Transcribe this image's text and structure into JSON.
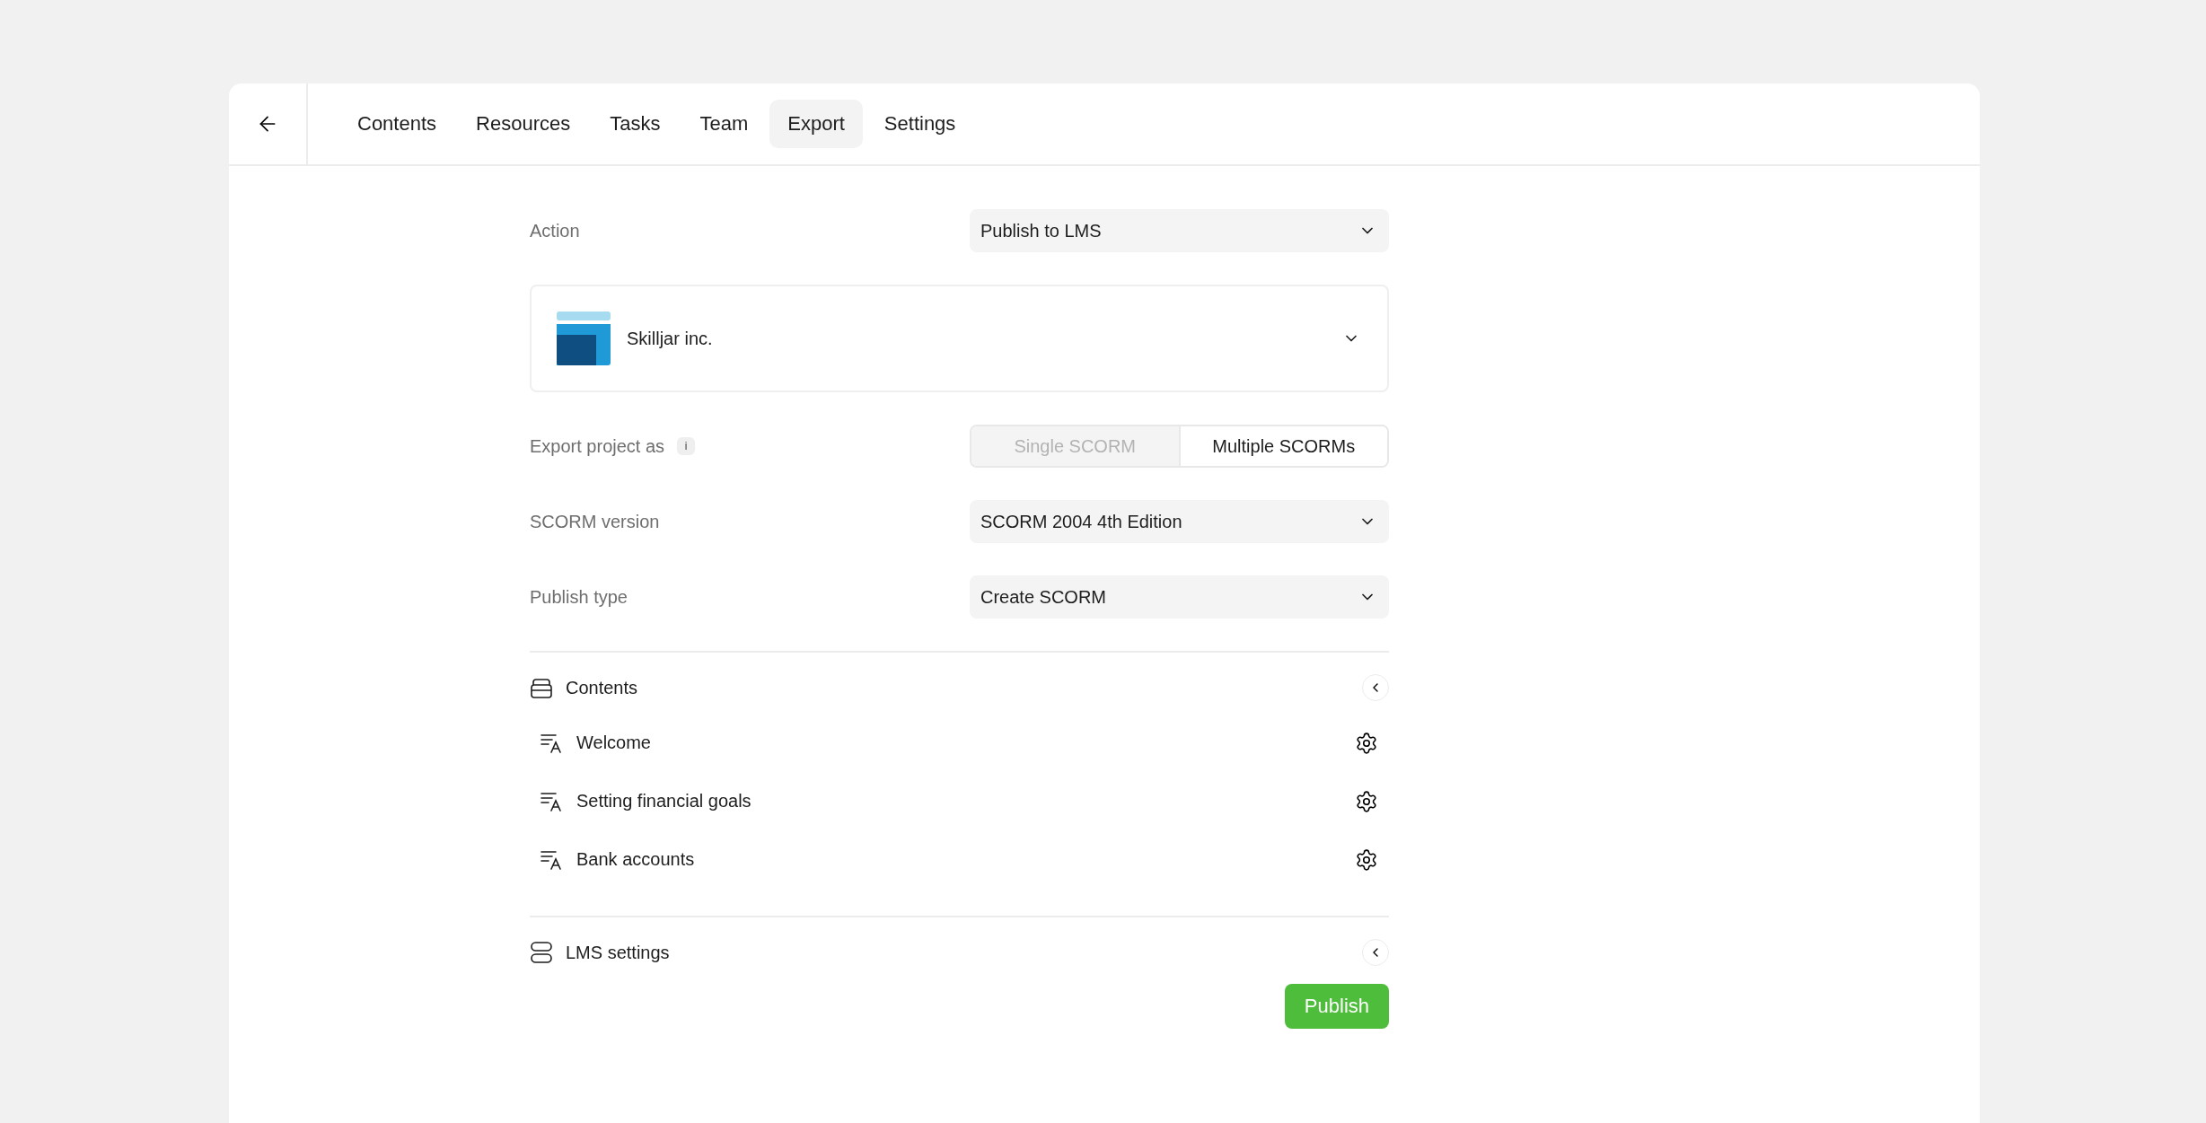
{
  "tabs": [
    {
      "label": "Contents",
      "selected": false
    },
    {
      "label": "Resources",
      "selected": false
    },
    {
      "label": "Tasks",
      "selected": false
    },
    {
      "label": "Team",
      "selected": false
    },
    {
      "label": "Export",
      "selected": true
    },
    {
      "label": "Settings",
      "selected": false
    }
  ],
  "fields": [
    {
      "kind": "select",
      "label": "Action",
      "value": "Publish to LMS"
    },
    {
      "kind": "account",
      "value": "Skilljar inc."
    },
    {
      "kind": "toggle",
      "label": "Export project as",
      "info": "i",
      "options": [
        {
          "label": "Single SCORM",
          "selected": false
        },
        {
          "label": "Multiple SCORMs",
          "selected": true
        }
      ]
    },
    {
      "kind": "select",
      "label": "SCORM version",
      "value": "SCORM 2004 4th Edition"
    },
    {
      "kind": "select",
      "label": "Publish type",
      "value": "Create SCORM"
    }
  ],
  "sections": [
    {
      "kind": "stack",
      "title": "Contents",
      "items": [
        "Welcome",
        "Setting financial goals",
        "Bank accounts"
      ]
    },
    {
      "kind": "server",
      "title": "LMS settings"
    }
  ],
  "publish_button": "Publish"
}
